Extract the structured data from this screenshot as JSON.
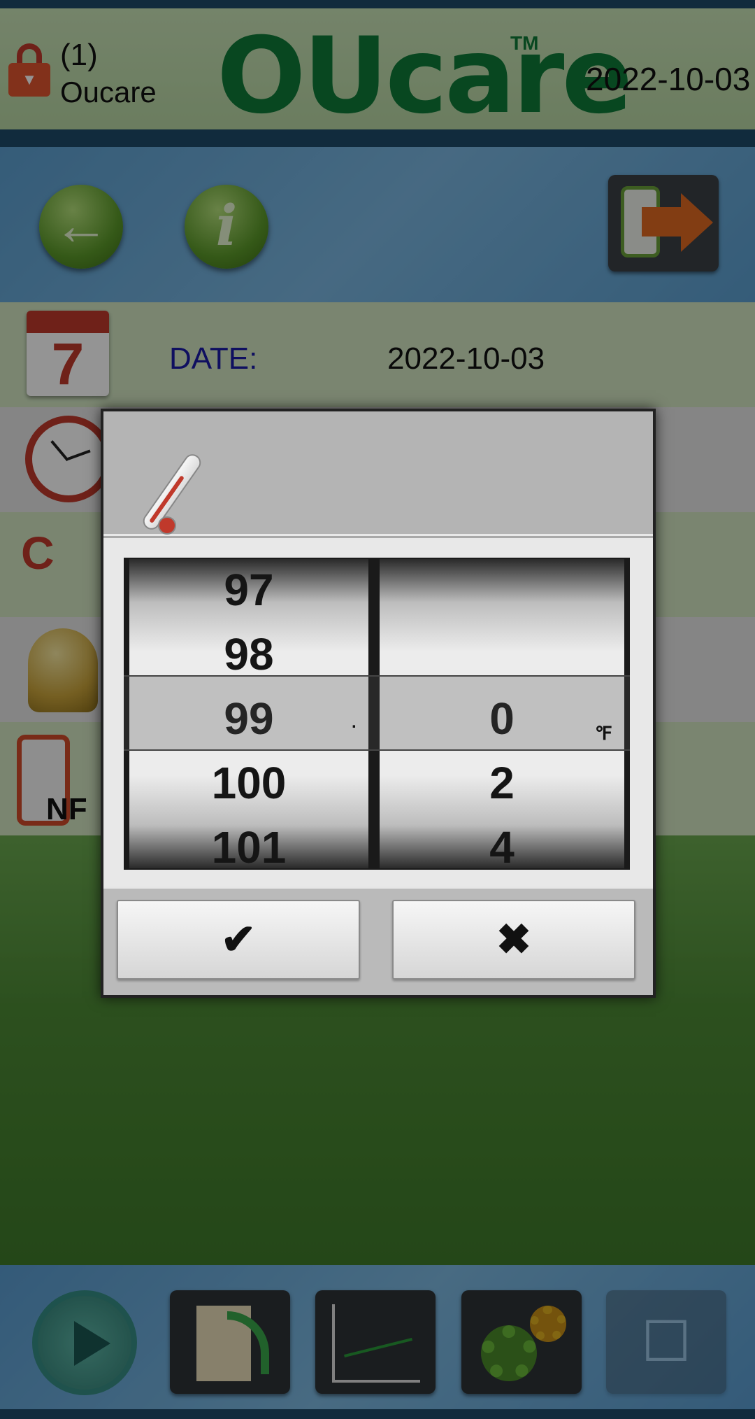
{
  "header": {
    "user_number": "(1)",
    "user_name": "Oucare",
    "logo": "OUcare",
    "trademark": "TM",
    "date": "2022-10-03"
  },
  "toolbar": {
    "back_icon": "←",
    "info_icon": "i"
  },
  "rows": {
    "date_label": "DATE:",
    "date_value": "2022-10-03",
    "calendar_day": "7",
    "temp_icon_text": "C",
    "nfc_text": "NF"
  },
  "dialog": {
    "integer_values": [
      "97",
      "98",
      "99",
      "100",
      "101"
    ],
    "decimal_values": [
      "",
      "",
      "0",
      "2",
      "4"
    ],
    "selected_integer": "99",
    "selected_decimal": "0",
    "decimal_point": ".",
    "unit": "℉",
    "ok_label": "✔",
    "cancel_label": "✖"
  },
  "colors": {
    "brand_green": "#0f7a38",
    "date_label_blue": "#1a1aa6",
    "accent_orange": "#e06a22"
  }
}
